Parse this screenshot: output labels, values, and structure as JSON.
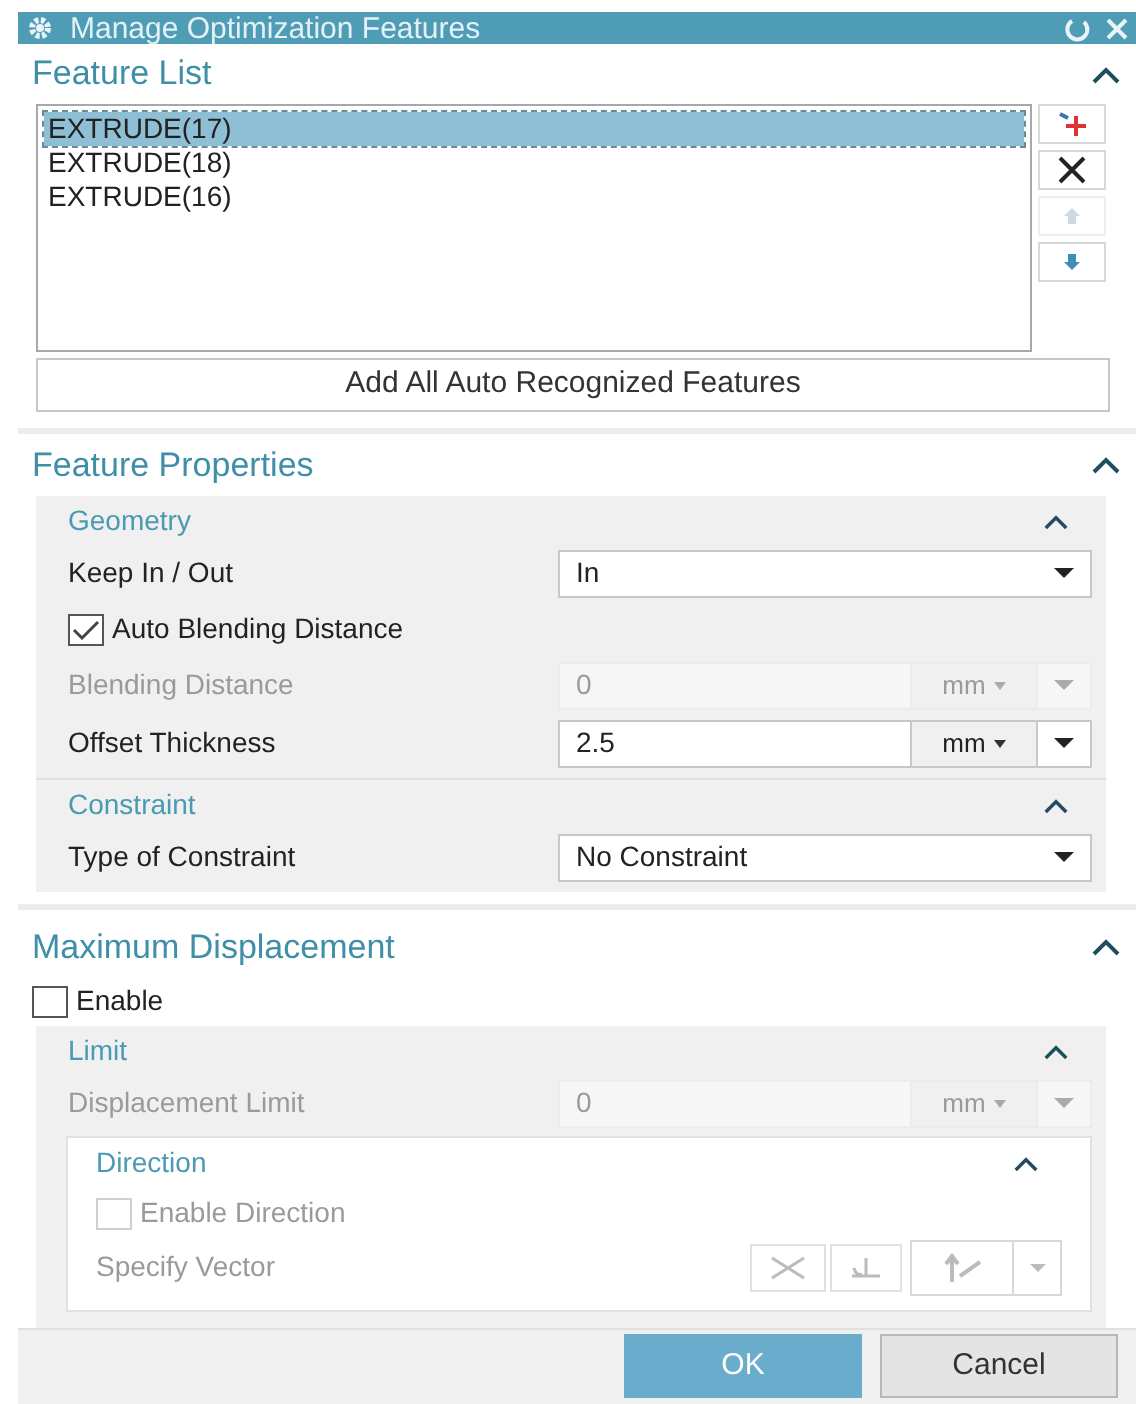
{
  "window": {
    "title": "Manage Optimization Features"
  },
  "feature_list": {
    "title": "Feature List",
    "expanded": true,
    "items": [
      {
        "label": "EXTRUDE(17)",
        "selected": true
      },
      {
        "label": "EXTRUDE(18)",
        "selected": false
      },
      {
        "label": "EXTRUDE(16)",
        "selected": false
      }
    ],
    "side_buttons": [
      {
        "kind": "add",
        "disabled": false
      },
      {
        "kind": "remove",
        "disabled": false
      },
      {
        "kind": "up",
        "disabled": true
      },
      {
        "kind": "down",
        "disabled": false
      }
    ],
    "add_all_button": "Add All Auto Recognized Features"
  },
  "feature_properties": {
    "title": "Feature Properties",
    "expanded": true,
    "groups": [
      {
        "title": "Geometry",
        "expanded": true,
        "rows": [
          {
            "kind": "dropdown",
            "label": "Keep In / Out",
            "value": "In",
            "disabled": false
          },
          {
            "kind": "checkbox",
            "label": "Auto Blending Distance",
            "checked": true,
            "disabled": false
          },
          {
            "kind": "unit_field",
            "label": "Blending Distance",
            "value": "0",
            "unit": "mm",
            "disabled": true
          },
          {
            "kind": "unit_field",
            "label": "Offset Thickness",
            "value": "2.5",
            "unit": "mm",
            "disabled": false
          }
        ]
      },
      {
        "title": "Constraint",
        "expanded": true,
        "rows": [
          {
            "kind": "dropdown",
            "label": "Type of Constraint",
            "value": "No Constraint",
            "disabled": false
          }
        ]
      }
    ]
  },
  "maximum_displacement": {
    "title": "Maximum Displacement",
    "expanded": true,
    "enable": {
      "label": "Enable",
      "checked": false
    },
    "limit": {
      "title": "Limit",
      "expanded": true,
      "rows": [
        {
          "kind": "unit_field",
          "label": "Displacement Limit",
          "value": "0",
          "unit": "mm",
          "disabled": true
        }
      ],
      "direction": {
        "title": "Direction",
        "expanded": true,
        "enable_direction": {
          "label": "Enable Direction",
          "checked": false,
          "disabled": true
        },
        "specify_vector": {
          "label": "Specify Vector",
          "disabled": true
        }
      }
    }
  },
  "buttons": [
    {
      "label": "OK",
      "kind": "primary"
    },
    {
      "label": "Cancel",
      "kind": "secondary"
    }
  ]
}
